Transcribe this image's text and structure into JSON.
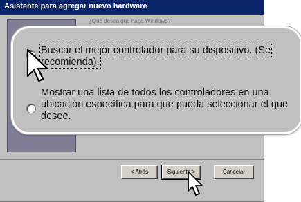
{
  "window": {
    "title": "Asistente para agregar nuevo hardware",
    "question": "¿Qué desea que haga Windows?"
  },
  "options": [
    {
      "label": "Buscar el mejor controlador para su dispositivo. (Se recomienda).",
      "selected": true
    },
    {
      "label": "Mostrar una lista de todos los controladores en una ubicación específica para que pueda seleccionar el que desee.",
      "selected": false
    }
  ],
  "buttons": {
    "back": "< Atrás",
    "next": "Siguiente >",
    "cancel": "Cancelar"
  },
  "colors": {
    "titlebar": "#0a246a",
    "dialog": "#c0c0c0",
    "wizard_image": "#7f7f95"
  },
  "icons": [
    "radio-selected-icon",
    "radio-unselected-icon",
    "arrow-cursor-icon"
  ]
}
